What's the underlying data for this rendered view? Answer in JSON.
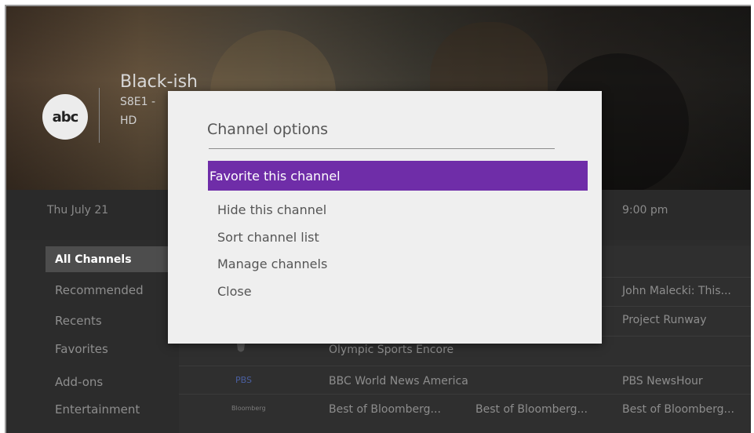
{
  "show": {
    "network_logo_text": "abc",
    "title": "Black-ish",
    "episode": "S8E1 -",
    "quality": "HD"
  },
  "timebar": {
    "date": "Thu July 21",
    "time": "9:00 pm"
  },
  "sidebar": {
    "items": [
      {
        "label": "All Channels",
        "active": true
      },
      {
        "label": "Recommended",
        "active": false
      },
      {
        "label": "Recents",
        "active": false
      },
      {
        "label": "Favorites",
        "active": false
      },
      {
        "label": "Add-ons",
        "active": false
      },
      {
        "label": "Entertainment",
        "active": false
      }
    ]
  },
  "guide": {
    "rows": [
      {
        "channel": "",
        "programs": [
          "",
          "",
          "John Malecki: This..."
        ]
      },
      {
        "channel": "",
        "programs": [
          "",
          "",
          "Project Runway"
        ]
      },
      {
        "channel": "",
        "programs": [
          "Olympic Sports Encore",
          "",
          ""
        ]
      },
      {
        "channel": "PBS",
        "programs": [
          "BBC World News America",
          "",
          "PBS NewsHour"
        ]
      },
      {
        "channel": "Bloomberg",
        "programs": [
          "Best of Bloomberg...",
          "Best of Bloomberg...",
          "Best of Bloomberg..."
        ]
      }
    ]
  },
  "modal": {
    "title": "Channel options",
    "options": [
      {
        "label": "Favorite this channel",
        "selected": true
      },
      {
        "label": "Hide this channel",
        "selected": false
      },
      {
        "label": "Sort channel list",
        "selected": false
      },
      {
        "label": "Manage channels",
        "selected": false
      },
      {
        "label": "Close",
        "selected": false
      }
    ]
  },
  "colors": {
    "accent": "#6f2da8",
    "modal_bg": "#efefef",
    "screen_bg": "#2c2c2c"
  }
}
